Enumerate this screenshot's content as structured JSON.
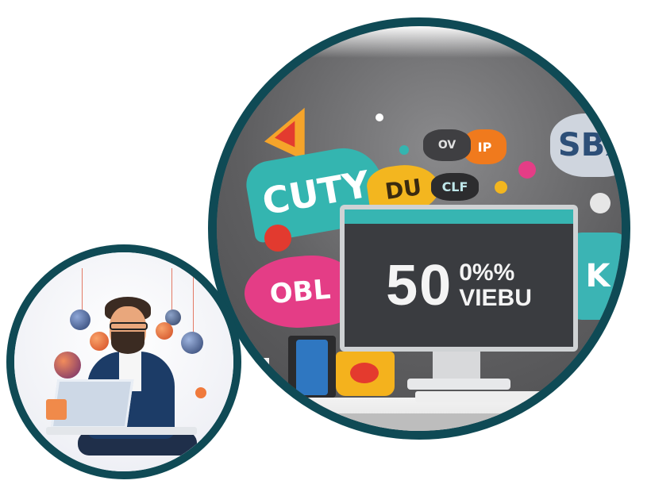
{
  "scene": {
    "description": "",
    "main_image": {
      "screen_number": "50",
      "screen_side_top": "0%%",
      "screen_side_bottom": "VIEBU",
      "bubbles": {
        "teal_big": "CUTY",
        "pink": "OBL",
        "yellow": "DU",
        "sbx": "SBX",
        "teal_right": "K",
        "orange_top": "IP",
        "gray_small": "OV",
        "small_dark": "CLF"
      }
    },
    "accent_color": "#0f4a55"
  }
}
